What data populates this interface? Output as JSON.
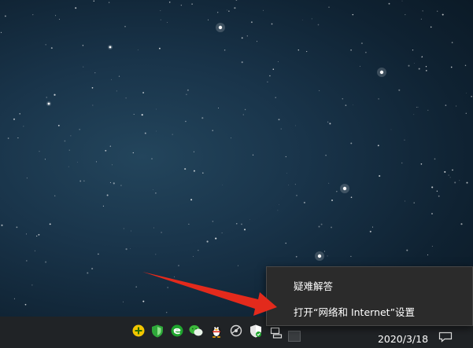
{
  "desktop": {
    "wallpaper": "starry-night-sky",
    "background_color": "#19344a"
  },
  "context_menu": {
    "items": [
      {
        "label": "疑难解答"
      },
      {
        "label": "打开“网络和 Internet”设置"
      }
    ],
    "background": "#2b2b2b"
  },
  "taskbar": {
    "background": "#202326",
    "tray_icons": [
      "add-circle-icon",
      "shield-security-icon",
      "browser-e-icon",
      "wechat-icon",
      "qq-penguin-icon",
      "network-tool-icon",
      "windows-defender-icon",
      "network-icon",
      "input-method-icon"
    ],
    "clock": {
      "date": "2020/3/18"
    }
  },
  "annotation": {
    "arrow_color": "#e32a1c"
  }
}
